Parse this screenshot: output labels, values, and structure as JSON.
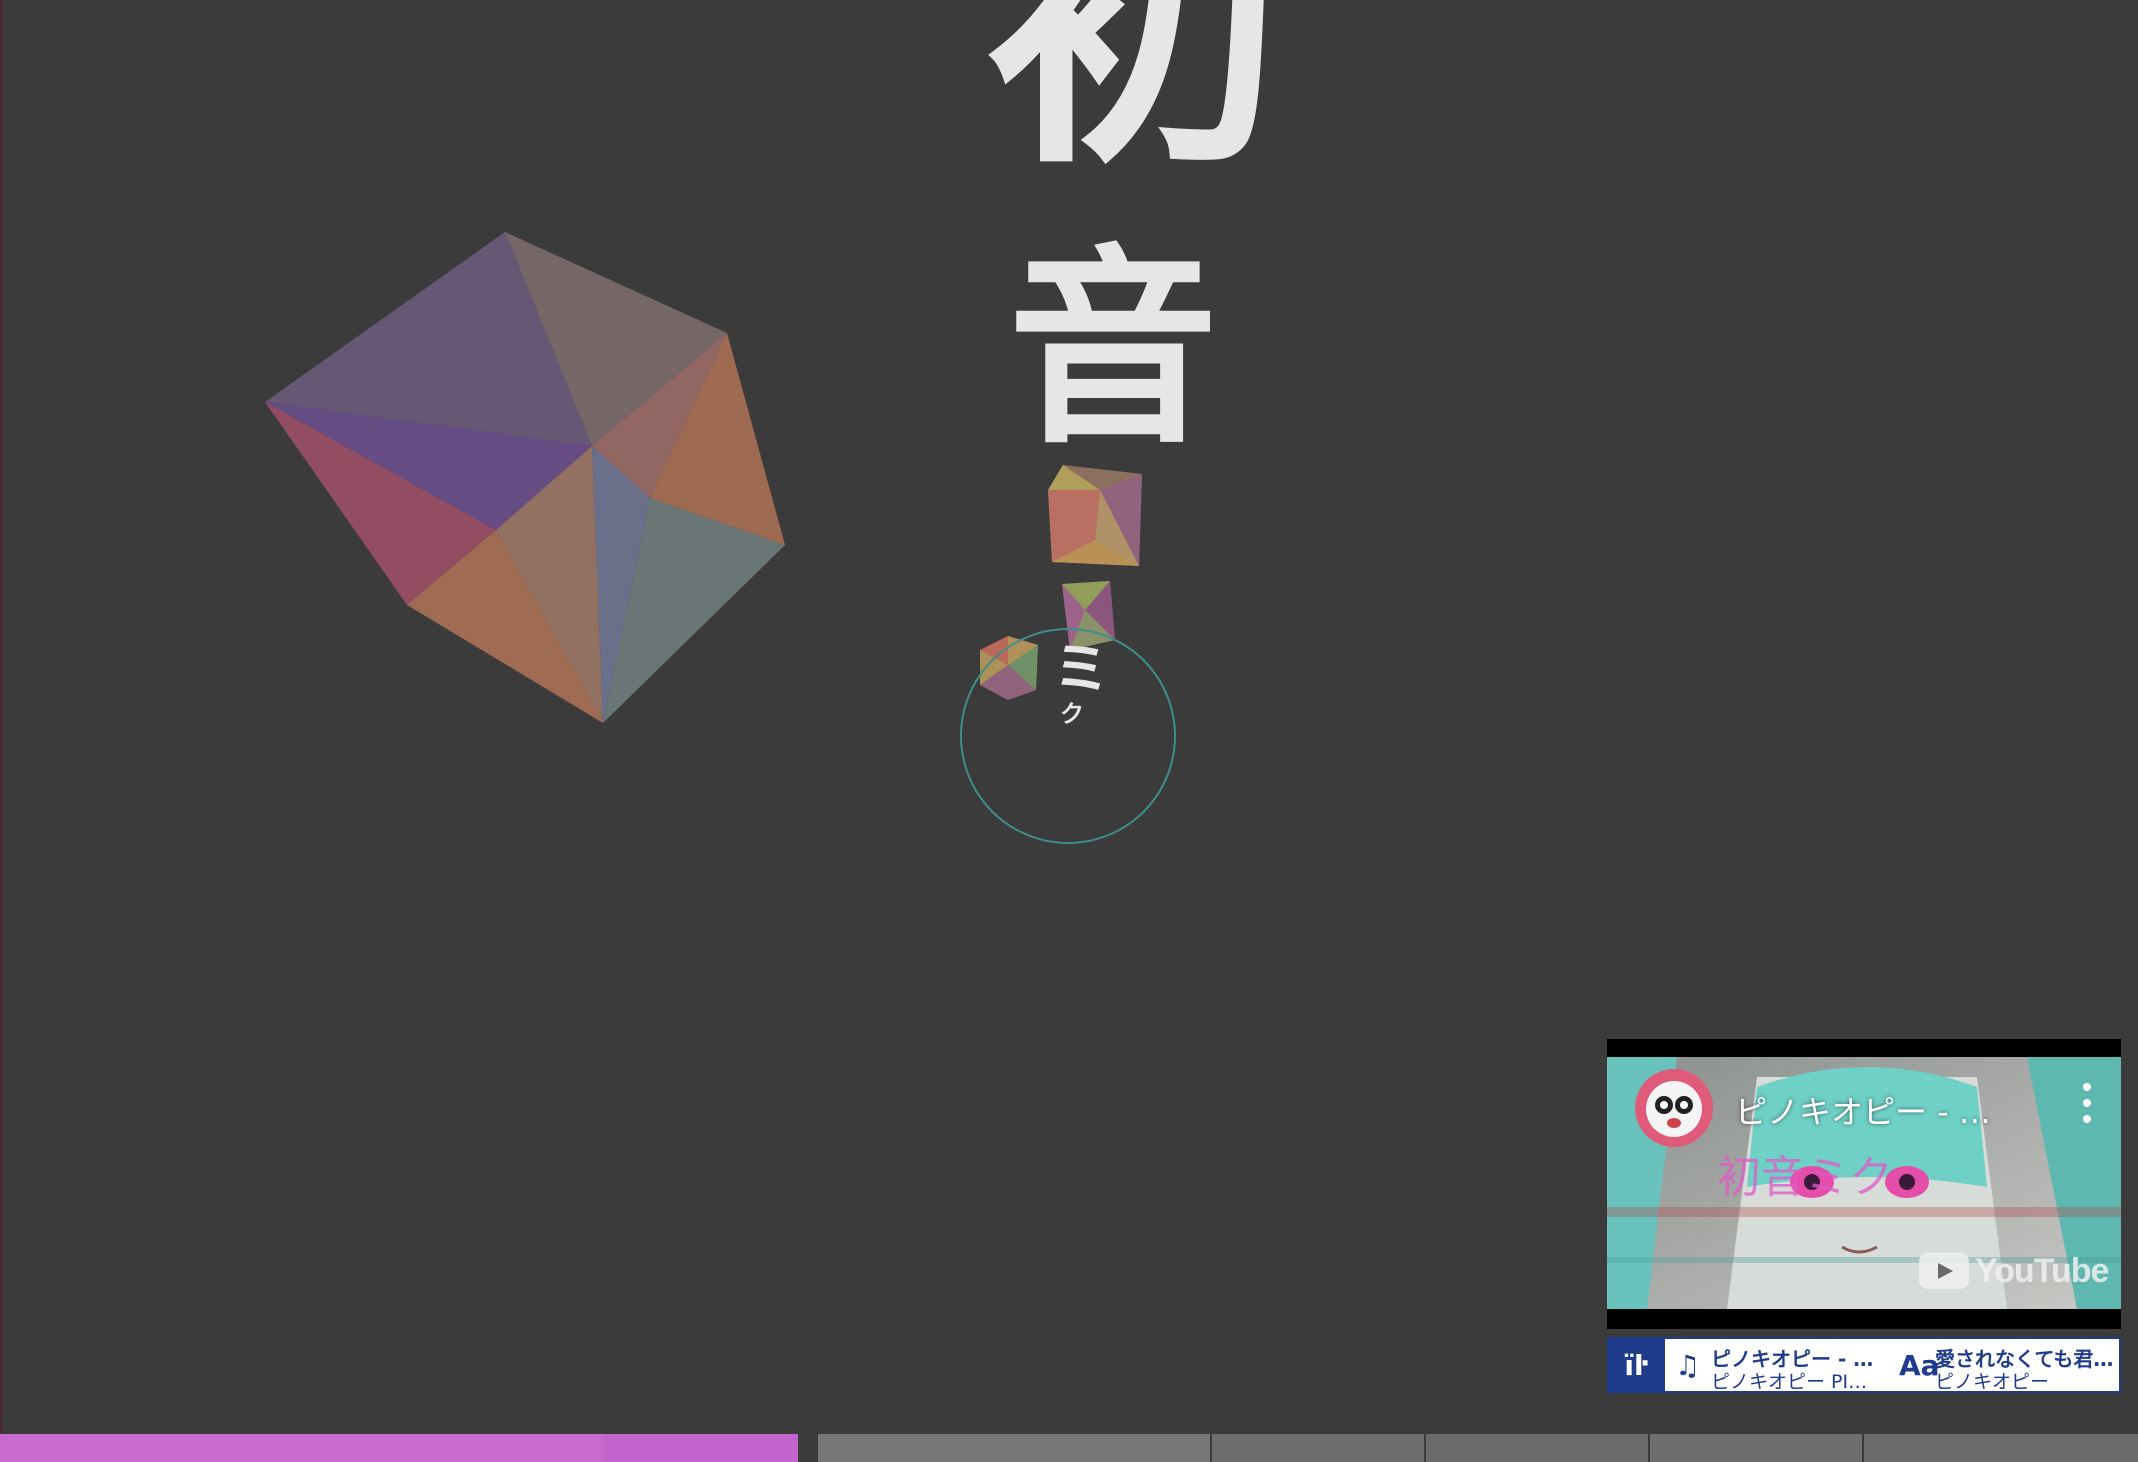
{
  "lyrics": {
    "char_1": "初",
    "char_2": "音",
    "char_3": "ミ",
    "char_4": "ク"
  },
  "player": {
    "video_title": "ピノキオピー - …",
    "youtube_label": "YouTube",
    "app_logo_text": "ïŀ",
    "song_icon": "♫",
    "song_title": "ピノキオピー - 愛…",
    "song_artist": "ピノキオピー PIN…",
    "lyrics_icon": "Aa",
    "lyrics_title": "愛されなくても君…",
    "lyrics_artist": "ピノキオピー"
  },
  "colors": {
    "background": "#3b3b3b",
    "lyric_text": "#e6e6e6",
    "timeline_active": "#c86ad0",
    "timeline_inactive": "#777777",
    "cursor_ring": "#3f8d8a",
    "brand_blue": "#1f3b8c"
  },
  "timeline": {
    "progress": 0.273
  }
}
